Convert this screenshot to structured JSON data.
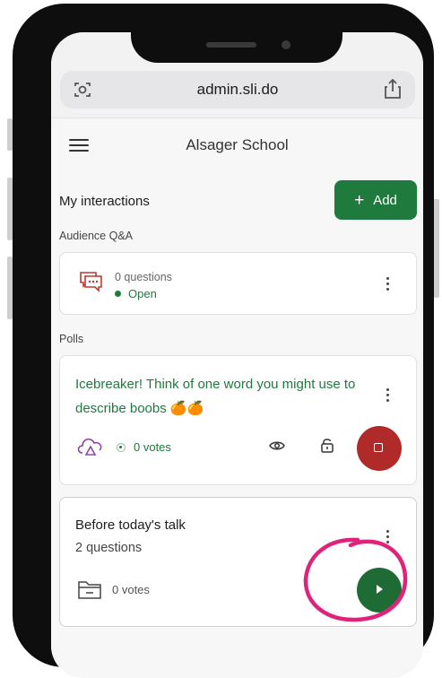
{
  "browser": {
    "url": "admin.sli.do"
  },
  "app": {
    "title": "Alsager School"
  },
  "interactions": {
    "heading": "My interactions",
    "add_label": "Add",
    "add_icon": "plus-icon"
  },
  "audience_qa": {
    "label": "Audience Q&A",
    "count": "0 questions",
    "status": "Open",
    "icon": "chat-bubble-icon"
  },
  "polls": {
    "label": "Polls",
    "items": [
      {
        "title": "Icebreaker! Think of one word you might use to describe boobs 🍊🍊",
        "votes": "0 votes",
        "state": "live",
        "accent": "#1f7a3d",
        "action": "stop"
      },
      {
        "title": "Before today's talk",
        "subtitle": "2 questions",
        "votes": "0 votes",
        "state": "inactive",
        "action": "play"
      }
    ]
  },
  "colors": {
    "brand_green": "#1f7a3d",
    "stop_red": "#b02a2a",
    "annotation_pink": "#e0237a"
  }
}
